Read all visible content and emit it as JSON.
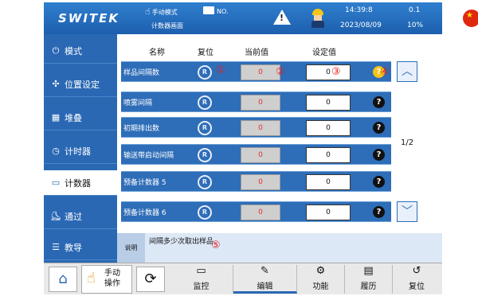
{
  "header": {
    "logo": "SWITEK",
    "mode": "手动模式",
    "screen": "计数器画面",
    "no_label": "NO.",
    "time": "14:39:8",
    "date": "2023/08/09",
    "version": "0.1",
    "percent": "10%"
  },
  "sidebar": {
    "items": [
      {
        "label": "模式",
        "icon": "mode-icon"
      },
      {
        "label": "位置设定",
        "icon": "position-icon"
      },
      {
        "label": "堆叠",
        "icon": "stack-icon"
      },
      {
        "label": "计时器",
        "icon": "timer-icon"
      },
      {
        "label": "计数器",
        "icon": "counter-icon"
      },
      {
        "label": "通过",
        "icon": "pass-icon"
      },
      {
        "label": "教导",
        "icon": "teach-icon"
      }
    ]
  },
  "table": {
    "headers": {
      "name": "名称",
      "reset": "复位",
      "current": "当前值",
      "setting": "设定值"
    },
    "reset_glyph": "R",
    "help_glyph": "?",
    "rows": [
      {
        "name": "样品间隔数",
        "current": "0",
        "setting": "0"
      },
      {
        "name": "喷雾间隔",
        "current": "0",
        "setting": "0"
      },
      {
        "name": "初期排出数",
        "current": "0",
        "setting": "0"
      },
      {
        "name": "输送带启动间隔",
        "current": "0",
        "setting": "0"
      },
      {
        "name": "预备计数器 5",
        "current": "0",
        "setting": "0"
      },
      {
        "name": "预备计数器 6",
        "current": "0",
        "setting": "0"
      }
    ],
    "page": "1/2"
  },
  "annotations": [
    "①",
    "②",
    "③",
    "④",
    "⑤"
  ],
  "help": {
    "label": "说明",
    "text": "间隔多少次取出样品"
  },
  "bottom": {
    "manual_line1": "手动",
    "manual_line2": "操作",
    "tabs": [
      "监控",
      "编辑",
      "功能",
      "履历",
      "复位"
    ]
  }
}
